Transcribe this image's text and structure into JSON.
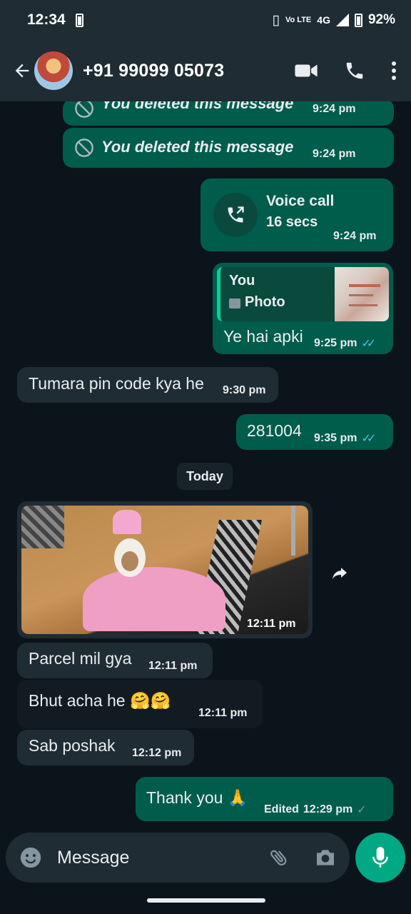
{
  "status_bar": {
    "time": "12:34",
    "network": "4G",
    "volte": "Vo LTE",
    "battery": "92%"
  },
  "header": {
    "contact": "+91 99099 05073"
  },
  "messages": {
    "deleted_1": {
      "text": "You deleted this message",
      "time": "9:24 pm"
    },
    "deleted_2": {
      "text": "You deleted this message",
      "time": "9:24 pm"
    },
    "voice_call": {
      "title": "Voice call",
      "duration": "16 secs",
      "time": "9:24 pm"
    },
    "reply": {
      "quoted_author": "You",
      "quoted_type": "Photo",
      "text": "Ye hai apki",
      "time": "9:25 pm"
    },
    "pin_question": {
      "text": "Tumara pin code kya he",
      "time": "9:30 pm"
    },
    "pin_answer": {
      "text": "281004",
      "time": "9:35 pm"
    },
    "date_divider": "Today",
    "photo": {
      "time": "12:11 pm"
    },
    "parcel": {
      "text": "Parcel mil gya",
      "time": "12:11 pm"
    },
    "bhut": {
      "text": "Bhut acha he 🤗🤗",
      "time": "12:11 pm"
    },
    "poshak": {
      "text": "Sab poshak",
      "time": "12:12 pm"
    },
    "thanks": {
      "text": "Thank you 🙏",
      "edited": "Edited",
      "time": "12:29 pm"
    }
  },
  "input": {
    "placeholder": "Message"
  },
  "colors": {
    "outgoing": "#005c4b",
    "incoming": "#202c33",
    "accent": "#00a884",
    "read_tick": "#53bdeb"
  }
}
